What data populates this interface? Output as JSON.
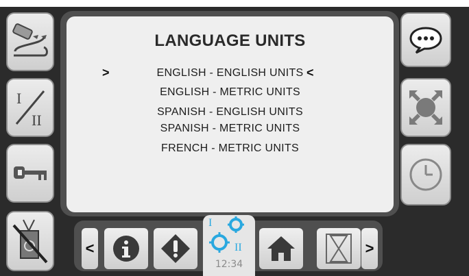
{
  "screen": {
    "title": "LANGUAGE UNITS",
    "options": [
      "ENGLISH - ENGLISH UNITS",
      "ENGLISH - METRIC UNITS",
      "SPANISH - ENGLISH UNITS",
      "SPANISH - METRIC UNITS",
      "FRENCH - METRIC UNITS"
    ],
    "selected_left_marker": ">",
    "selected_right_marker": "<"
  },
  "left_buttons": [
    {
      "icon": "sensor-tilt-icon"
    },
    {
      "icon": "mode-one-two-icon"
    },
    {
      "icon": "key-icon"
    },
    {
      "icon": "antenna-disabled-icon"
    }
  ],
  "right_buttons": [
    {
      "icon": "chat-bubble-icon"
    },
    {
      "icon": "fullscreen-disabled-icon"
    },
    {
      "icon": "clock-icon"
    }
  ],
  "bottom_bar": {
    "prev_label": "<",
    "next_label": ">",
    "time": "12:34",
    "icons": [
      "info-icon",
      "warning-icon",
      "settings-gears-icon",
      "home-icon",
      "hourglass-icon"
    ]
  },
  "colors": {
    "accent_blue": "#29a8df",
    "panel_dark": "#2b2b2b",
    "screen_bg": "#efefef"
  }
}
